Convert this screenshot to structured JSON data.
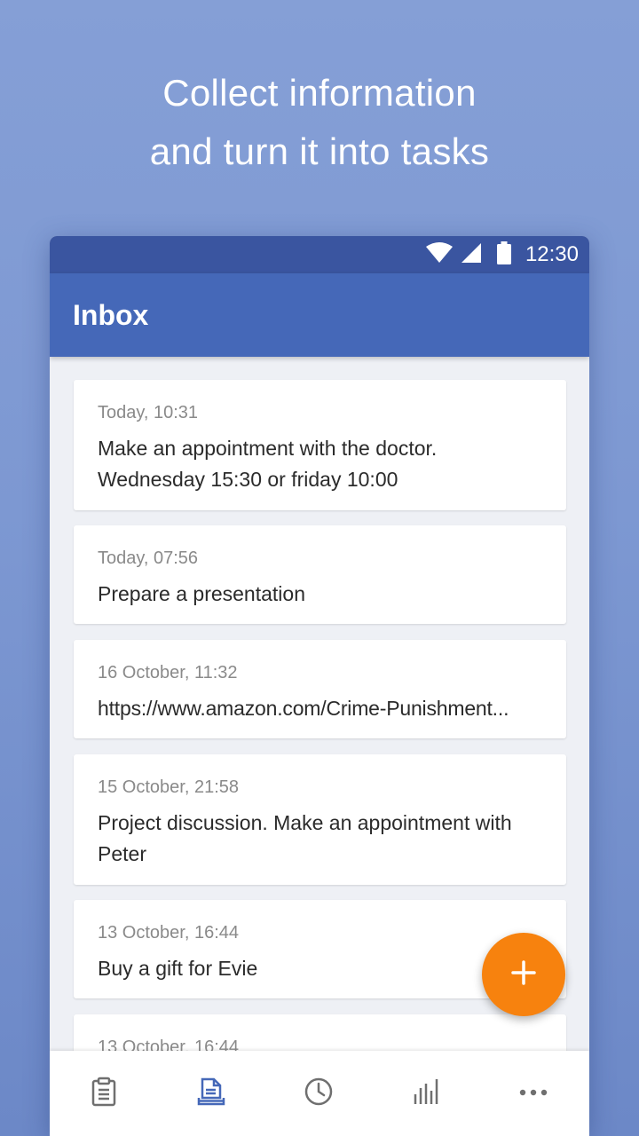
{
  "promo": {
    "line1": "Collect information",
    "line2": "and turn it into tasks"
  },
  "status_bar": {
    "time": "12:30",
    "icons": [
      "wifi-icon",
      "cellular-signal-icon",
      "battery-icon"
    ]
  },
  "app_bar": {
    "title": "Inbox"
  },
  "inbox": {
    "items": [
      {
        "time": "Today, 10:31",
        "text": "Make an appointment with the doctor. Wednesday 15:30 or friday 10:00"
      },
      {
        "time": "Today, 07:56",
        "text": "Prepare a presentation"
      },
      {
        "time": "16 October, 11:32",
        "text": "https://www.amazon.com/Crime-Punishment..."
      },
      {
        "time": "15 October, 21:58",
        "text": "Project discussion. Make an appointment with Peter"
      },
      {
        "time": "13 October, 16:44",
        "text": "Buy a gift for Evie"
      },
      {
        "time": "13 October, 16:44",
        "text": ""
      }
    ]
  },
  "fab": {
    "icon": "plus-icon"
  },
  "bottom_nav": {
    "items": [
      {
        "icon": "clipboard-icon",
        "active": false
      },
      {
        "icon": "inbox-icon",
        "active": true
      },
      {
        "icon": "clock-icon",
        "active": false
      },
      {
        "icon": "bar-chart-icon",
        "active": false
      },
      {
        "icon": "more-icon",
        "active": false
      }
    ]
  },
  "colors": {
    "background": "#809bd4",
    "status_bar": "#3a55a0",
    "app_bar": "#4568b8",
    "accent": "#f7820e",
    "nav_active": "#4568b8",
    "nav_inactive": "#6f6f6f"
  }
}
